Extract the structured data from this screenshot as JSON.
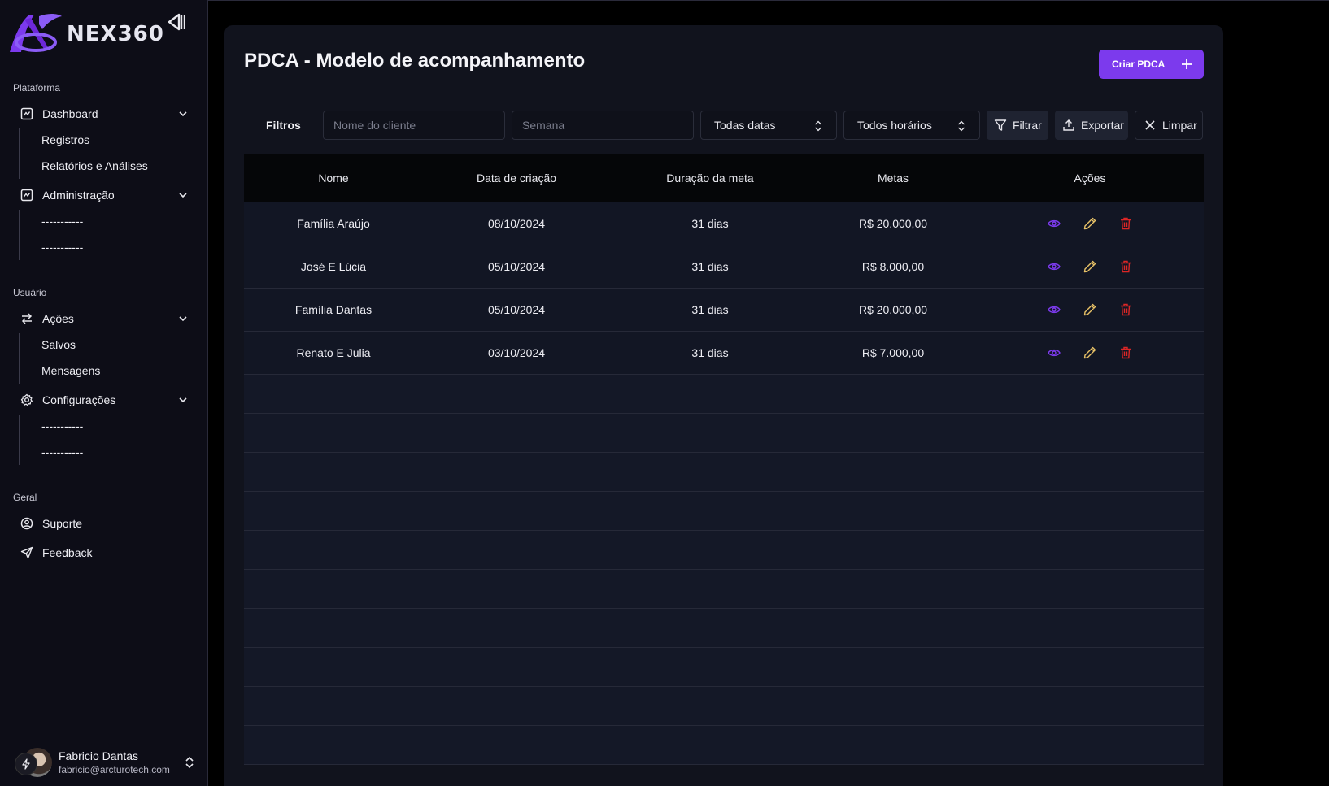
{
  "brand": {
    "name": "NEX360"
  },
  "sidebar": {
    "sections": [
      {
        "label": "Plataforma"
      },
      {
        "label": "Usuário"
      },
      {
        "label": "Geral"
      }
    ],
    "items": {
      "dashboard": {
        "label": "Dashboard",
        "icon": "dashboard-icon",
        "children": [
          "Registros",
          "Relatórios e Análises"
        ]
      },
      "administracao": {
        "label": "Administração",
        "icon": "admin-icon",
        "children": [
          "-----------",
          "-----------"
        ]
      },
      "acoes": {
        "label": "Ações",
        "icon": "arrows-icon",
        "children": [
          "Salvos",
          "Mensagens"
        ]
      },
      "configuracoes": {
        "label": "Configurações",
        "icon": "gear-icon",
        "children": [
          "-----------",
          "-----------"
        ]
      },
      "suporte": {
        "label": "Suporte",
        "icon": "support-icon"
      },
      "feedback": {
        "label": "Feedback",
        "icon": "send-icon"
      }
    },
    "user": {
      "name": "Fabricio Dantas",
      "email": "fabricio@arcturotech.com"
    }
  },
  "main": {
    "title": "PDCA - Modelo de acompanhamento",
    "create_label": "Criar PDCA",
    "filters": {
      "label": "Filtros",
      "client_placeholder": "Nome do cliente",
      "week_placeholder": "Semana",
      "date_select": "Todas datas",
      "time_select": "Todos horários",
      "filter_label": "Filtrar",
      "export_label": "Exportar",
      "clear_label": "Limpar"
    },
    "table": {
      "headers": [
        "Nome",
        "Data de criação",
        "Duração da meta",
        "Metas",
        "Ações"
      ],
      "rows": [
        [
          "Família Araújo",
          "08/10/2024",
          "31 dias",
          "R$ 20.000,00"
        ],
        [
          "José E Lúcia",
          "05/10/2024",
          "31 dias",
          "R$ 8.000,00"
        ],
        [
          "Família Dantas",
          "05/10/2024",
          "31 dias",
          "R$ 20.000,00"
        ],
        [
          "Renato E Julia",
          "03/10/2024",
          "31 dias",
          "R$ 7.000,00"
        ]
      ]
    }
  },
  "colors": {
    "accent": "#7c3aed",
    "view": "#7c3aed",
    "edit": "#e8c267",
    "delete": "#dc2626"
  }
}
